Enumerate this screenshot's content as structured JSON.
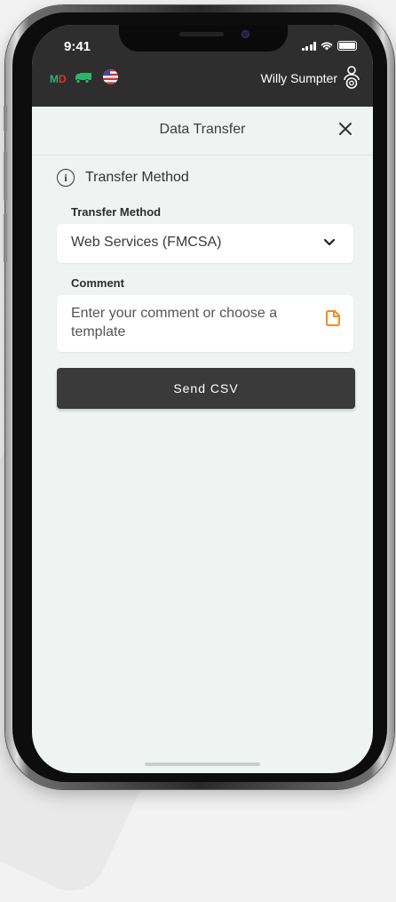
{
  "status_bar": {
    "time": "9:41"
  },
  "app_header": {
    "status_letters": {
      "m": "M",
      "d": "D"
    },
    "user_name": "Willy Sumpter"
  },
  "dialog": {
    "title": "Data Transfer",
    "section_title": "Transfer Method",
    "transfer_method_label": "Transfer Method",
    "transfer_method_value": "Web Services (FMCSA)",
    "comment_label": "Comment",
    "comment_placeholder": "Enter your comment or choose a template",
    "comment_value": "",
    "send_button_label": "Send CSV"
  },
  "colors": {
    "header_bg": "#2e2e2e",
    "screen_bg": "#eff4f3",
    "button_bg": "#3a3a3a",
    "status_green": "#2fb36b",
    "status_red": "#e03131",
    "template_icon_orange": "#f08c2a"
  },
  "icons": [
    "truck-icon",
    "us-flag-icon",
    "user-badge-icon",
    "close-icon",
    "info-icon",
    "chevron-down-icon",
    "template-icon"
  ]
}
